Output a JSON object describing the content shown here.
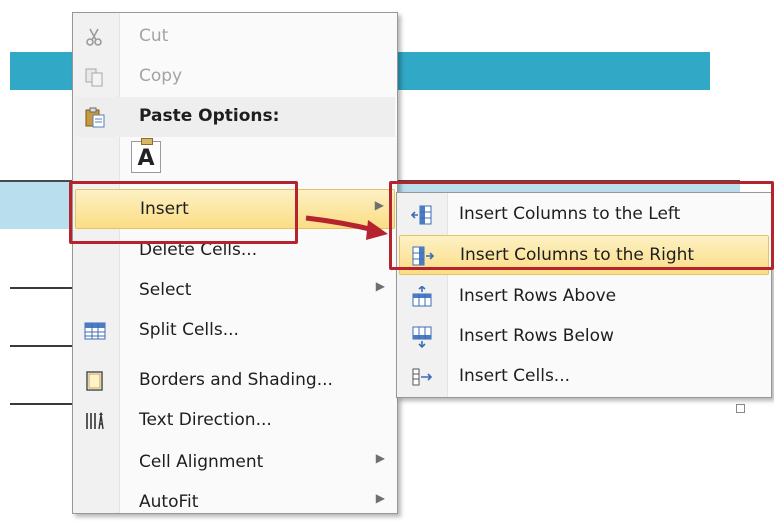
{
  "accent_color": "#b5232e",
  "highlight_color": "#fbdd84",
  "context_menu": {
    "items": [
      {
        "label": "Cut",
        "icon": "scissors-icon",
        "enabled": false
      },
      {
        "label": "Copy",
        "icon": "copy-icon",
        "enabled": false
      },
      {
        "label": "Paste Options:",
        "icon": "paste-icon",
        "section": true
      },
      {
        "label": "A",
        "icon": "keep-text-only-icon",
        "paste_option": true
      },
      {
        "label": "Insert",
        "submenu": true,
        "highlighted": true
      },
      {
        "label": "Delete Cells...",
        "icon": null
      },
      {
        "label": "Select",
        "submenu": true
      },
      {
        "label": "Split Cells...",
        "icon": "split-cells-icon"
      },
      {
        "label": "Borders and Shading...",
        "icon": "borders-shading-icon"
      },
      {
        "label": "Text Direction...",
        "icon": "text-direction-icon"
      },
      {
        "label": "Cell Alignment",
        "submenu": true
      },
      {
        "label": "AutoFit",
        "submenu": true
      }
    ]
  },
  "insert_submenu": {
    "items": [
      {
        "label": "Insert Columns to the Left",
        "icon": "insert-columns-left-icon"
      },
      {
        "label": "Insert Columns to the Right",
        "icon": "insert-columns-right-icon",
        "highlighted": true
      },
      {
        "label": "Insert Rows Above",
        "icon": "insert-rows-above-icon"
      },
      {
        "label": "Insert Rows Below",
        "icon": "insert-rows-below-icon"
      },
      {
        "label": "Insert Cells...",
        "icon": "insert-cells-icon"
      }
    ]
  }
}
